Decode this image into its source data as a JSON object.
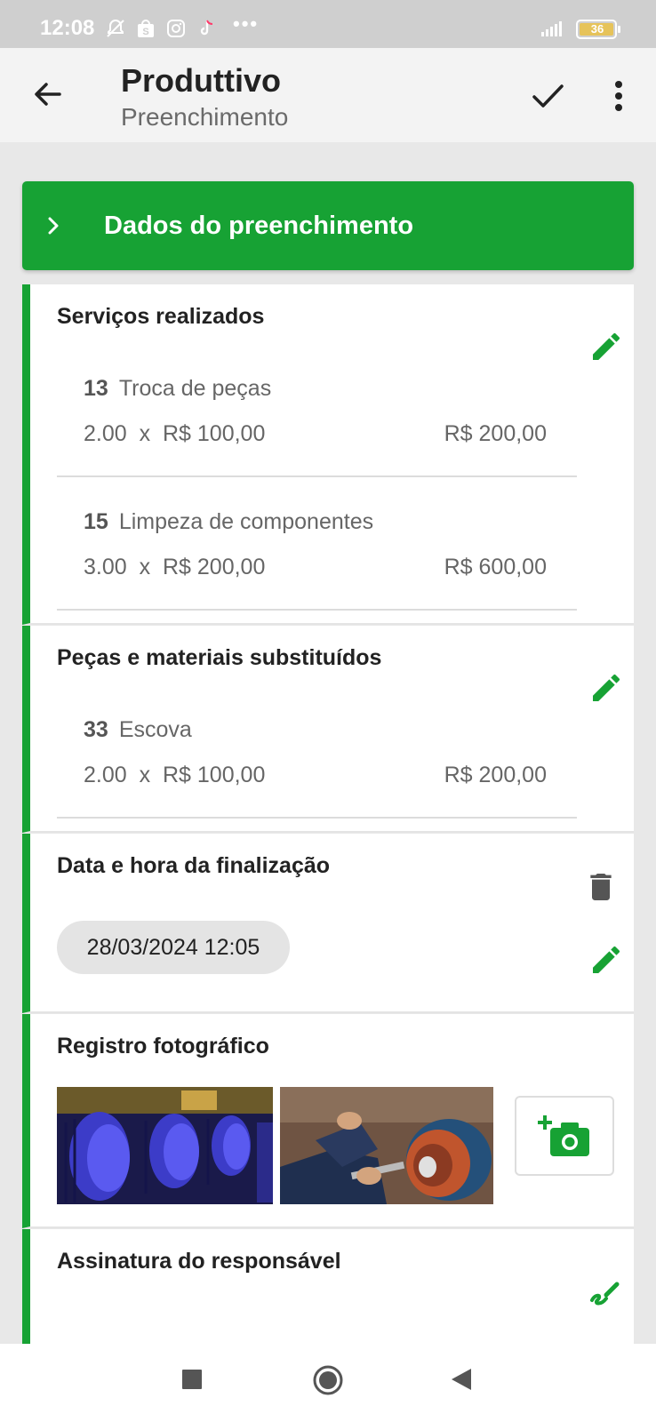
{
  "status_bar": {
    "time": "12:08",
    "more": "•••",
    "battery": "36",
    "icons": [
      "bell-off-icon",
      "shop-icon",
      "instagram-icon",
      "tiktok-icon"
    ]
  },
  "app_bar": {
    "title": "Produttivo",
    "subtitle": "Preenchimento"
  },
  "section_header": {
    "label": "Dados do preenchimento"
  },
  "services": {
    "title": "Serviços realizados",
    "items": [
      {
        "num": "13",
        "name": "Troca de peças",
        "qty": "2.00",
        "x": "x",
        "price": "R$ 100,00",
        "total": "R$ 200,00"
      },
      {
        "num": "15",
        "name": "Limpeza de componentes",
        "qty": "3.00",
        "x": "x",
        "price": "R$ 200,00",
        "total": "R$ 600,00"
      }
    ]
  },
  "parts": {
    "title": "Peças e materiais substituídos",
    "items": [
      {
        "num": "33",
        "name": "Escova",
        "qty": "2.00",
        "x": "x",
        "price": "R$ 100,00",
        "total": "R$ 200,00"
      }
    ]
  },
  "finalization": {
    "title": "Data e hora da finalização",
    "value": "28/03/2024 12:05"
  },
  "photos": {
    "title": "Registro fotográfico"
  },
  "signature": {
    "title": "Assinatura do responsável"
  },
  "colors": {
    "accent": "#17a234",
    "text": "#222222",
    "muted": "#666666"
  }
}
